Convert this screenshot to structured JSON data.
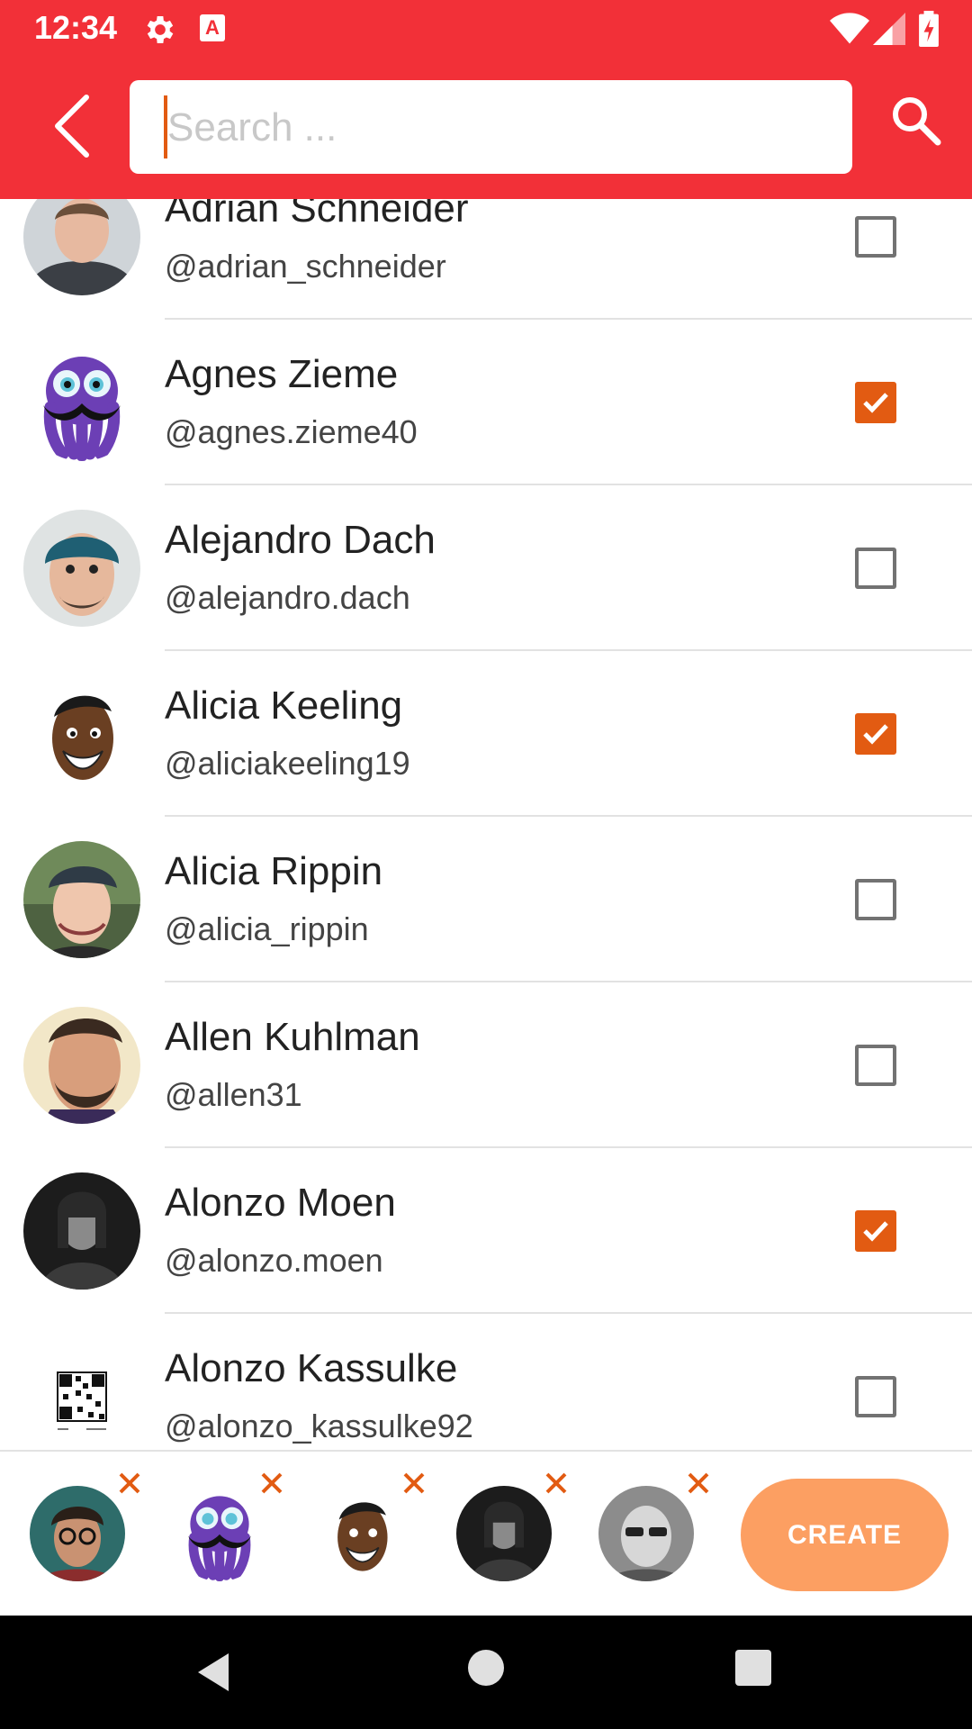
{
  "status_bar": {
    "time": "12:34",
    "notification_icon_letter": "A"
  },
  "search": {
    "placeholder": "Search ..."
  },
  "colors": {
    "app_bar": "#f23038",
    "accent": "#e25b12",
    "create_button": "#fc9f62"
  },
  "contacts": [
    {
      "name": "Adrian Schneider",
      "handle": "@adrian_schneider",
      "checked": false,
      "avatar": "man-photo-icon"
    },
    {
      "name": "Agnes Zieme",
      "handle": "@agnes.zieme40",
      "checked": true,
      "avatar": "purple-octopus-mustache-icon"
    },
    {
      "name": "Alejandro Dach",
      "handle": "@alejandro.dach",
      "checked": false,
      "avatar": "man-beanie-photo-icon"
    },
    {
      "name": "Alicia Keeling",
      "handle": "@aliciakeeling19",
      "checked": true,
      "avatar": "cartoon-smiling-face-icon"
    },
    {
      "name": "Alicia Rippin",
      "handle": "@alicia_rippin",
      "checked": false,
      "avatar": "man-cap-photo-icon"
    },
    {
      "name": "Allen Kuhlman",
      "handle": "@allen31",
      "checked": false,
      "avatar": "man-beard-photo-icon"
    },
    {
      "name": "Alonzo Moen",
      "handle": "@alonzo.moen",
      "checked": true,
      "avatar": "man-bw-photo-icon"
    },
    {
      "name": "Alonzo Kassulke",
      "handle": "@alonzo_kassulke92",
      "checked": false,
      "avatar": "qr-code-icon"
    }
  ],
  "selected": [
    {
      "avatar": "man-glasses-photo-icon"
    },
    {
      "avatar": "purple-octopus-mustache-icon"
    },
    {
      "avatar": "cartoon-smiling-face-icon"
    },
    {
      "avatar": "man-bw-photo-icon"
    },
    {
      "avatar": "man-sunglasses-photo-icon"
    }
  ],
  "create_button": {
    "label": "CREATE"
  }
}
